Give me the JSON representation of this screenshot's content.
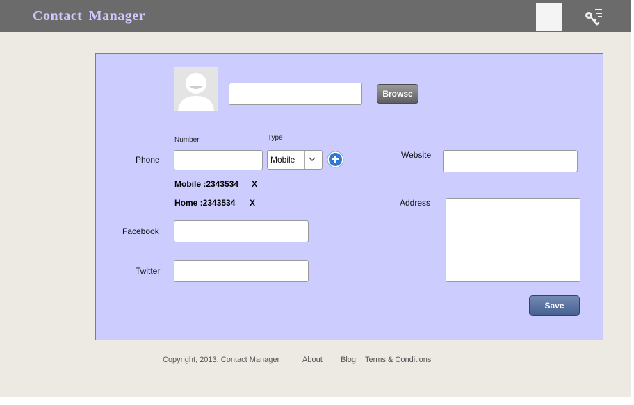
{
  "header": {
    "title": "Contact  Manager"
  },
  "form": {
    "phone": {
      "label": "Phone",
      "number_label": "Number",
      "type_label": "Type",
      "number_value": "",
      "type_value": "Mobile",
      "entries": [
        {
          "text": "Mobile :2343534",
          "remove": "X"
        },
        {
          "text": "Home :2343534",
          "remove": "X"
        }
      ]
    },
    "facebook_label": "Facebook",
    "twitter_label": "Twitter",
    "website_label": "Website",
    "address_label": "Address",
    "browse_label": "Browse",
    "save_label": "Save"
  },
  "footer": {
    "copyright": "Copyright, 2013. Contact Manager",
    "links": [
      "About",
      "Blog",
      "Terms & Conditions"
    ]
  },
  "colors": {
    "topbar": "#6b6b6b",
    "title": "#cdc9ff",
    "panel": "#ccccff",
    "save_button": "#46608f",
    "add_icon": "#2f77d4"
  }
}
